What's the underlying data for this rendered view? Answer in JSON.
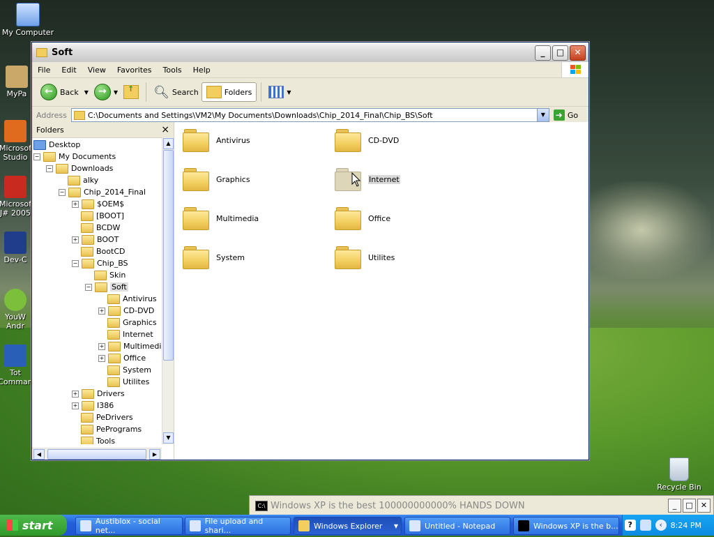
{
  "desktop": {
    "icons": [
      {
        "label": "My Computer"
      },
      {
        "label": "MyPa"
      },
      {
        "label": "Microsof Studio"
      },
      {
        "label": "Microsof J# 2005"
      },
      {
        "label": "Dev-C"
      },
      {
        "label": "YouW Andr"
      },
      {
        "label": "Tot Comman"
      },
      {
        "label": "Recycle Bin"
      }
    ]
  },
  "window": {
    "title": "Soft",
    "menu": [
      "File",
      "Edit",
      "View",
      "Favorites",
      "Tools",
      "Help"
    ],
    "toolbar": {
      "back": "Back",
      "search": "Search",
      "folders": "Folders"
    },
    "address": {
      "label": "Address",
      "value": "C:\\Documents and Settings\\VM2\\My Documents\\Downloads\\Chip_2014_Final\\Chip_BS\\Soft",
      "go": "Go"
    },
    "folders_pane": {
      "title": "Folders",
      "close": "×",
      "tree": [
        {
          "label": "Desktop"
        },
        {
          "label": "My Documents"
        },
        {
          "label": "Downloads"
        },
        {
          "label": "alky"
        },
        {
          "label": "Chip_2014_Final"
        },
        {
          "label": "$OEM$"
        },
        {
          "label": "[BOOT]"
        },
        {
          "label": "BCDW"
        },
        {
          "label": "BOOT"
        },
        {
          "label": "BootCD"
        },
        {
          "label": "Chip_BS"
        },
        {
          "label": "Skin"
        },
        {
          "label": "Soft"
        },
        {
          "label": "Antivirus"
        },
        {
          "label": "CD-DVD"
        },
        {
          "label": "Graphics"
        },
        {
          "label": "Internet"
        },
        {
          "label": "Multimedia"
        },
        {
          "label": "Office"
        },
        {
          "label": "System"
        },
        {
          "label": "Utilites"
        },
        {
          "label": "Drivers"
        },
        {
          "label": "I386"
        },
        {
          "label": "PeDrivers"
        },
        {
          "label": "PePrograms"
        },
        {
          "label": "Tools"
        }
      ]
    },
    "main_folders": [
      {
        "label": "Antivirus"
      },
      {
        "label": "CD-DVD"
      },
      {
        "label": "Graphics"
      },
      {
        "label": "Internet"
      },
      {
        "label": "Multimedia"
      },
      {
        "label": "Office"
      },
      {
        "label": "System"
      },
      {
        "label": "Utilites"
      }
    ]
  },
  "console": {
    "icon_text": "C:\\",
    "title": "Windows XP is the best 100000000000% HANDS DOWN"
  },
  "taskbar": {
    "start": "start",
    "tasks": [
      {
        "label": "Austiblox - social net..."
      },
      {
        "label": "File upload and shari..."
      },
      {
        "label": "Windows Explorer"
      },
      {
        "label": "Untitled - Notepad"
      },
      {
        "label": "Windows XP is the b..."
      }
    ],
    "clock": "8:24 PM"
  }
}
